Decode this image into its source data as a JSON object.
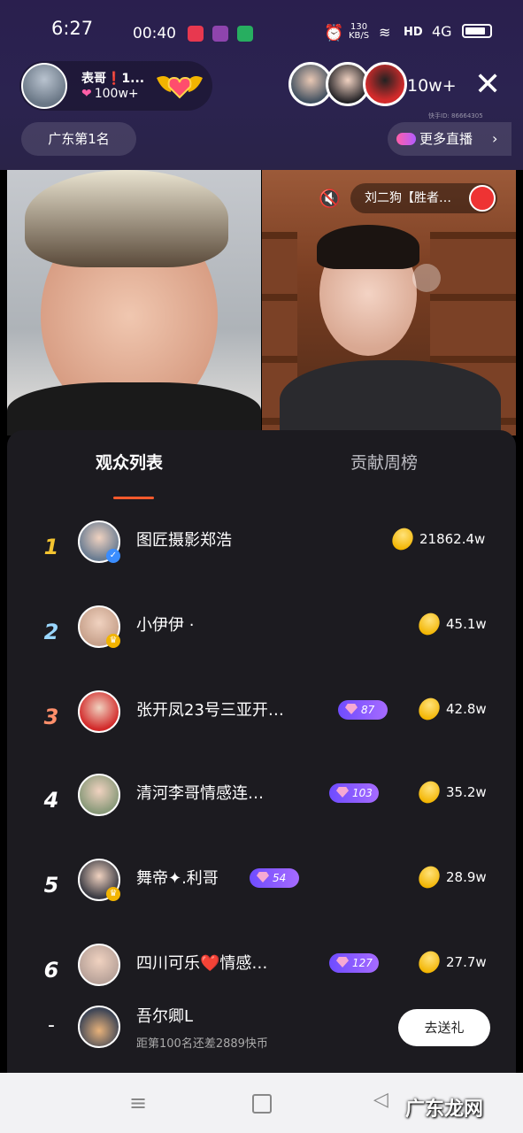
{
  "status_bar": {
    "time": "6:27",
    "duration": "00:40",
    "net_speed": "130",
    "net_unit": "KB/S",
    "hd": "HD",
    "network": "4G"
  },
  "live_header": {
    "host_name": "表哥❗1...",
    "host_likes": "100w+",
    "viewer_count": "10w+",
    "room_id": "快手ID: 86664305",
    "rank_label": "广东第1名",
    "more_live_label": "更多直播"
  },
  "guest": {
    "name": "刘二狗【胜者…"
  },
  "tabs": {
    "audience": "观众列表",
    "contribution": "贡献周榜"
  },
  "viewers": [
    {
      "rank": "1",
      "name": "图匠摄影郑浩",
      "level": "",
      "score": "21862.4w",
      "rank_color": "#f4c430",
      "avatar_color": "#6b7d92",
      "badge": "✓",
      "badge_color": "#3a8dff"
    },
    {
      "rank": "2",
      "name": "小伊伊 ·",
      "level": "",
      "score": "45.1w",
      "rank_color": "#9ad7ff",
      "avatar_color": "#c8a28c",
      "badge": "♛",
      "badge_color": "#f2b400"
    },
    {
      "rank": "3",
      "name": "张开凤23号三亚开…",
      "level": "87",
      "score": "42.8w",
      "rank_color": "#ff8f6b",
      "avatar_color": "#d22b2b",
      "badge": "",
      "badge_color": ""
    },
    {
      "rank": "4",
      "name": "清河李哥情感连…",
      "level": "103",
      "score": "35.2w",
      "rank_color": "#ffffff",
      "avatar_color": "#8a9a7a",
      "badge": "",
      "badge_color": ""
    },
    {
      "rank": "5",
      "name": "舞帝✦.利哥",
      "level": "54",
      "score": "28.9w",
      "rank_color": "#ffffff",
      "avatar_color": "#3c3c44",
      "badge": "♛",
      "badge_color": "#f2b400"
    },
    {
      "rank": "6",
      "name": "四川可乐❤️情感…",
      "level": "127",
      "score": "27.7w",
      "rank_color": "#ffffff",
      "avatar_color": "#b9a39a",
      "badge": "",
      "badge_color": ""
    }
  ],
  "self": {
    "rank": "-",
    "name": "吾尔卿L",
    "gap": "距第100名还差2889快币",
    "gift_button": "去送礼"
  },
  "watermark": "广东龙网"
}
